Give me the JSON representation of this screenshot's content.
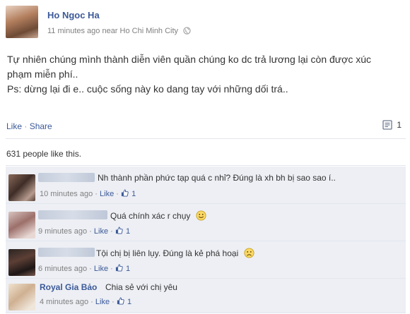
{
  "post": {
    "author": "Ho Ngoc Ha",
    "meta": "11 minutes ago near Ho Chi Minh City",
    "lines": [
      "Tự nhiên chúng mình thành diễn viên quần chúng ko dc trả lương lại còn được xúc",
      "phạm miễn phí..",
      "Ps: dừng lại đi e.. cuộc sống này ko dang tay với những dối trá.."
    ],
    "actions": {
      "like": "Like",
      "share": "Share",
      "sep": "·"
    },
    "comment_count": "1",
    "likes_summary": "631 people like this."
  },
  "comments": [
    {
      "name": "",
      "text": "Nh thành phần phức tạp quá c nhỉ? Đúng là xh bh bị sao sao í..",
      "time": "10 minutes ago",
      "like": "Like",
      "likes": "1",
      "emoticon": "none"
    },
    {
      "name": "",
      "text": "Quá chính xác r chụy",
      "time": "9 minutes ago",
      "like": "Like",
      "likes": "1",
      "emoticon": "smile"
    },
    {
      "name": "",
      "text": "Tội chị bị liên lụy. Đúng là kẻ phá hoại",
      "time": "6 minutes ago",
      "like": "Like",
      "likes": "1",
      "emoticon": "frown"
    },
    {
      "name": "Royal Gia Bảo",
      "text": "Chia sẻ với chị yêu",
      "time": "4 minutes ago",
      "like": "Like",
      "likes": "1",
      "emoticon": "none"
    }
  ],
  "colors": {
    "link": "#3b5998",
    "comment_bg": "#edeff4",
    "meta": "#808080"
  },
  "icons": [
    "globe-icon",
    "comment-icon",
    "thumbs-up-icon",
    "smile-emoticon-icon",
    "frown-emoticon-icon"
  ]
}
